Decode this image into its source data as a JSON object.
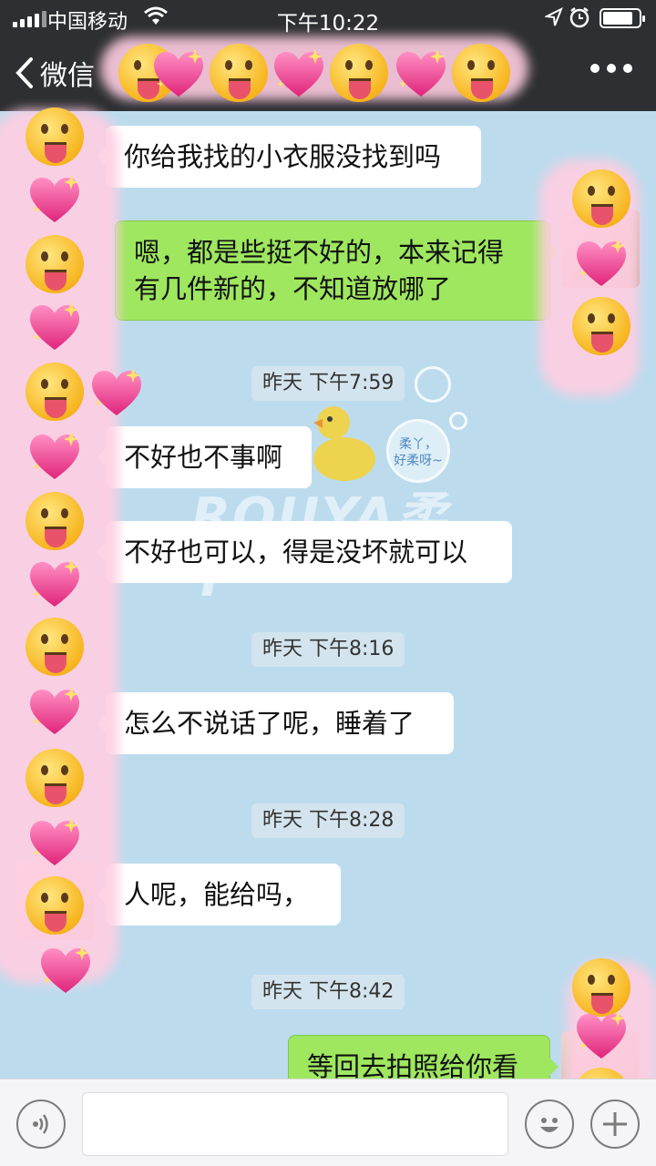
{
  "status_bar": {
    "carrier": "中国移动",
    "time": "下午10:22",
    "battery_level": 0.85
  },
  "nav": {
    "back_label": "微信",
    "more_icon": "more-dots-icon"
  },
  "watermark": {
    "brand": "ROUYA柔Y",
    "circle_text_line1": "柔丫，",
    "circle_text_line2": "好柔呀~"
  },
  "messages": [
    {
      "type": "in",
      "text": "你给我找的小衣服没找到吗"
    },
    {
      "type": "out",
      "text_line1": "嗯，都是些挺不好的，本来记得",
      "text_line2": "有几件新的，不知道放哪了"
    },
    {
      "type": "time",
      "text": "昨天 下午7:59"
    },
    {
      "type": "in",
      "text": "不好也不事啊"
    },
    {
      "type": "in",
      "text": "不好也可以，得是没坏就可以"
    },
    {
      "type": "time",
      "text": "昨天 下午8:16"
    },
    {
      "type": "in",
      "text": "怎么不说话了呢，睡着了"
    },
    {
      "type": "time",
      "text": "昨天 下午8:28"
    },
    {
      "type": "in",
      "text": "人呢，能给吗，"
    },
    {
      "type": "time",
      "text": "昨天 下午8:42"
    },
    {
      "type": "out",
      "text": "等回去拍照给你看"
    }
  ],
  "input_bar": {
    "voice_icon": "voice-icon",
    "input_value": "",
    "emoji_icon": "emoji-smile-icon",
    "plus_icon": "plus-icon"
  }
}
